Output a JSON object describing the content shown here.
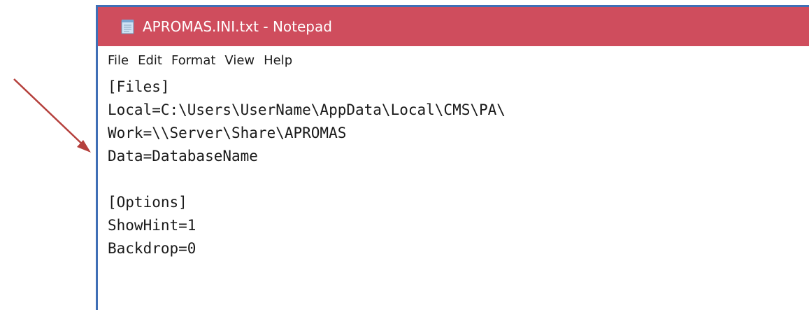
{
  "window": {
    "title": "APROMAS.INI.txt - Notepad",
    "title_bar_color": "#cf4d5d",
    "border_color": "#3f6fb6"
  },
  "menu": {
    "items": [
      {
        "label": "File"
      },
      {
        "label": "Edit"
      },
      {
        "label": "Format"
      },
      {
        "label": "View"
      },
      {
        "label": "Help"
      }
    ]
  },
  "editor": {
    "lines": [
      "[Files]",
      "Local=C:\\Users\\UserName\\AppData\\Local\\CMS\\PA\\",
      "Work=\\\\Server\\Share\\APROMAS",
      "Data=DatabaseName",
      "",
      "[Options]",
      "ShowHint=1",
      "Backdrop=0"
    ]
  },
  "annotation": {
    "arrow_color": "#b5403c",
    "points_to_line": "Work=\\\\Server\\Share\\APROMAS"
  }
}
